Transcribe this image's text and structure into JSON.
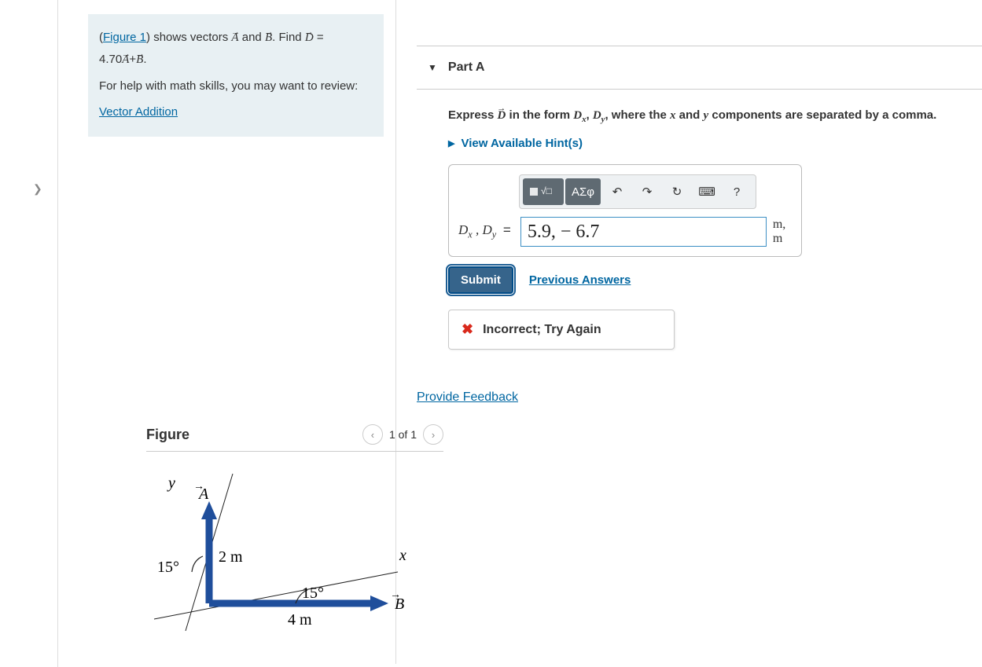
{
  "problem": {
    "figure_link": "Figure 1",
    "pre_figure": "(",
    "post_figure": ") shows vectors ",
    "vec_a": "A",
    "and": " and ",
    "vec_b": "B",
    "find_pre": ". Find ",
    "vec_d": "D",
    "equals": " = ",
    "coef": "4.70",
    "plus": "+",
    "period": ".",
    "help_line": "For help with math skills, you may want to review:",
    "review_link": "Vector Addition"
  },
  "figure": {
    "title": "Figure",
    "counter": "1 of 1",
    "labels": {
      "y": "y",
      "x": "x",
      "A": "A",
      "B": "B",
      "len_a": "2 m",
      "len_b": "4 m",
      "angle15": "15°"
    }
  },
  "part": {
    "label": "Part A",
    "instruction_pre": "Express ",
    "vec_d": "D",
    "instruction_mid1": " in the form ",
    "dx_sym": "D",
    "dx_sub": "x",
    "comma1": ", ",
    "dy_sym": "D",
    "dy_sub": "y",
    "instruction_mid2": ", where the ",
    "x": "x",
    "instruction_and": " and ",
    "y": "y",
    "instruction_end": " components are separated by a comma.",
    "hints": "View Available Hint(s)",
    "toolbar": {
      "greek": "ΑΣφ"
    },
    "lhs": {
      "dx": "D",
      "dx_sub": "x",
      "comma": " , ",
      "dy": "D",
      "dy_sub": "y",
      "eq": " = "
    },
    "answer_value": "5.9, − 6.7",
    "units": "m, m",
    "submit": "Submit",
    "previous": "Previous Answers",
    "feedback": "Incorrect; Try Again"
  },
  "provide_feedback": "Provide Feedback"
}
